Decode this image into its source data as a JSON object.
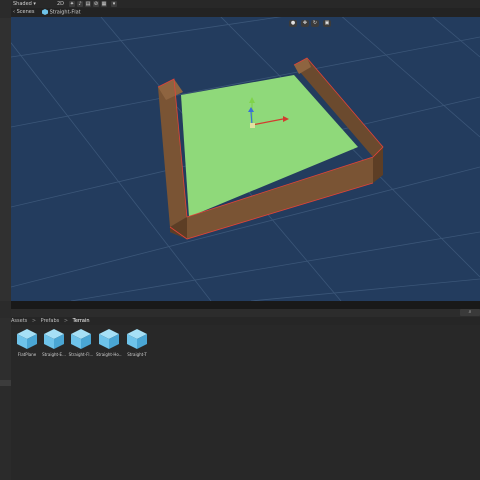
{
  "toolbar": {
    "shading_mode": "Shaded",
    "mode_2d": "2D",
    "icons": [
      "lighting-icon",
      "audio-icon",
      "effects-icon",
      "hidden-icon",
      "camera-icon",
      "gizmos-icon"
    ]
  },
  "tabs": {
    "scenes_label": "Scenes",
    "prefab_label": "Straight-Flat"
  },
  "scene_tools": [
    "orbit-icon",
    "move-tool-icon",
    "rotate-tool-icon",
    "scale-tool-icon"
  ],
  "breadcrumb": {
    "items": [
      "Assets",
      "Prefabs",
      "Terrain"
    ],
    "separator": ">"
  },
  "assets": [
    {
      "label": "FlatPlane"
    },
    {
      "label": "Straight-E..."
    },
    {
      "label": "Straight-Fl..."
    },
    {
      "label": "Straight-Ho..."
    },
    {
      "label": "Straight-T"
    }
  ],
  "colors": {
    "scene_bg": "#233c5e",
    "grid": "#3b5678",
    "floor": "#8fd97a",
    "wall": "#7a5434",
    "wall_dark": "#5d3e25",
    "selection_outline": "#e0433a",
    "asset_icon": "#6ec3ea"
  }
}
